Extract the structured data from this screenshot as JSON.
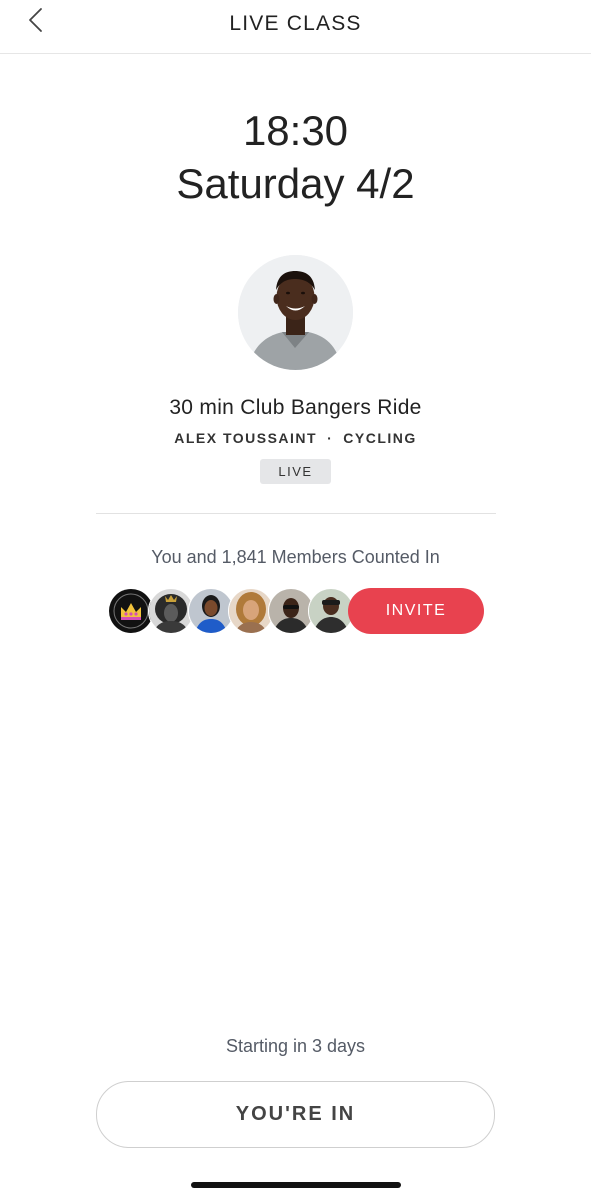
{
  "header": {
    "title": "LIVE CLASS",
    "back_icon": "chevron-left-icon"
  },
  "schedule": {
    "time": "18:30",
    "date": "Saturday 4/2"
  },
  "class": {
    "title": "30 min Club Bangers Ride",
    "instructor": "ALEX TOUSSAINT",
    "separator": "·",
    "discipline": "CYCLING",
    "badge": "LIVE"
  },
  "members": {
    "counted_in_text": "You and 1,841 Members Counted In",
    "invite_label": "INVITE"
  },
  "footer": {
    "starting_text": "Starting in 3 days",
    "cta_label": "YOU'RE IN"
  },
  "colors": {
    "accent": "#e8424f",
    "badge_bg": "#e5e6e8",
    "muted_text": "#555b66"
  }
}
